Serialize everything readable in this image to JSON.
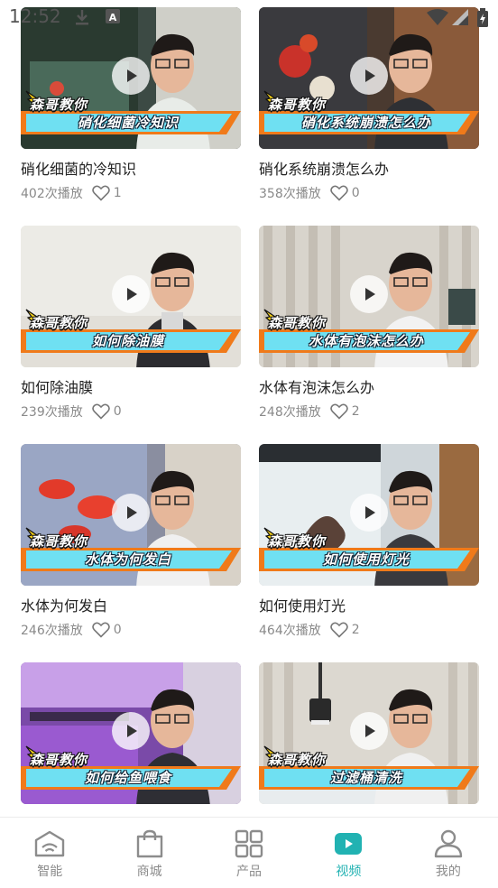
{
  "status_bar": {
    "time": "12:52"
  },
  "videos": [
    {
      "title": "硝化细菌的冷知识",
      "banner_title": "硝化细菌冷知识",
      "plays": "402次播放",
      "likes": "1",
      "scene": "aquarium"
    },
    {
      "title": "硝化系统崩溃怎么办",
      "banner_title": "硝化系统崩溃怎么办",
      "plays": "358次播放",
      "likes": "0",
      "scene": "koi"
    },
    {
      "title": "如何除油膜",
      "banner_title": "如何除油膜",
      "plays": "239次播放",
      "likes": "0",
      "scene": "wall"
    },
    {
      "title": "水体有泡沫怎么办",
      "banner_title": "水体有泡沫怎么办",
      "plays": "248次播放",
      "likes": "2",
      "scene": "curtain"
    },
    {
      "title": "水体为何发白",
      "banner_title": "水体为何发白",
      "plays": "246次播放",
      "likes": "0",
      "scene": "redfish"
    },
    {
      "title": "如何使用灯光",
      "banner_title": "如何使用灯光",
      "plays": "464次播放",
      "likes": "2",
      "scene": "tank"
    },
    {
      "title": "",
      "banner_title": "如何给鱼喂食",
      "plays": "",
      "likes": "",
      "scene": "purple"
    },
    {
      "title": "",
      "banner_title": "过滤桶清洗",
      "plays": "",
      "likes": "",
      "scene": "lamp"
    }
  ],
  "banner_label": "森哥教你",
  "nav": {
    "items": [
      {
        "label": "智能",
        "icon": "smart-home-icon"
      },
      {
        "label": "商城",
        "icon": "shopping-bag-icon"
      },
      {
        "label": "产品",
        "icon": "grid-icon"
      },
      {
        "label": "视频",
        "icon": "video-play-icon"
      },
      {
        "label": "我的",
        "icon": "user-icon"
      }
    ],
    "active_index": 3
  },
  "colors": {
    "accent": "#21b2b2",
    "banner_orange": "#f07a1a",
    "banner_cyan": "#6fe0f2"
  }
}
